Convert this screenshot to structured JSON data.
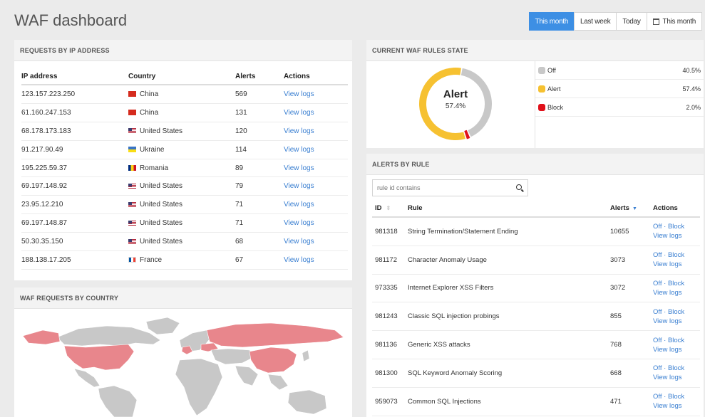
{
  "title": "WAF dashboard",
  "date_range": {
    "buttons": [
      "This month",
      "Last week",
      "Today"
    ],
    "picker_label": "This month",
    "active": "This month"
  },
  "ip_panel": {
    "title": "REQUESTS BY IP ADDRESS",
    "columns": [
      "IP address",
      "Country",
      "Alerts",
      "Actions"
    ],
    "rows": [
      {
        "ip": "123.157.223.250",
        "country": "China",
        "flag": "cn",
        "alerts": "569",
        "action": "View logs"
      },
      {
        "ip": "61.160.247.153",
        "country": "China",
        "flag": "cn",
        "alerts": "131",
        "action": "View logs"
      },
      {
        "ip": "68.178.173.183",
        "country": "United States",
        "flag": "us",
        "alerts": "120",
        "action": "View logs"
      },
      {
        "ip": "91.217.90.49",
        "country": "Ukraine",
        "flag": "ua",
        "alerts": "114",
        "action": "View logs"
      },
      {
        "ip": "195.225.59.37",
        "country": "Romania",
        "flag": "ro",
        "alerts": "89",
        "action": "View logs"
      },
      {
        "ip": "69.197.148.92",
        "country": "United States",
        "flag": "us",
        "alerts": "79",
        "action": "View logs"
      },
      {
        "ip": "23.95.12.210",
        "country": "United States",
        "flag": "us",
        "alerts": "71",
        "action": "View logs"
      },
      {
        "ip": "69.197.148.87",
        "country": "United States",
        "flag": "us",
        "alerts": "71",
        "action": "View logs"
      },
      {
        "ip": "50.30.35.150",
        "country": "United States",
        "flag": "us",
        "alerts": "68",
        "action": "View logs"
      },
      {
        "ip": "188.138.17.205",
        "country": "France",
        "flag": "fr",
        "alerts": "67",
        "action": "View logs"
      }
    ]
  },
  "map_panel": {
    "title": "WAF REQUESTS BY COUNTRY",
    "highlight_color": "#e8868c",
    "base_color": "#c8c8c8"
  },
  "state_panel": {
    "title": "CURRENT WAF RULES STATE",
    "center_label": "Alert",
    "center_value": "57.4%",
    "legend": [
      {
        "name": "Off",
        "pct": "40.5%",
        "value": 40.5,
        "color": "#c8c8c8"
      },
      {
        "name": "Alert",
        "pct": "57.4%",
        "value": 57.4,
        "color": "#f6c131"
      },
      {
        "name": "Block",
        "pct": "2.0%",
        "value": 2.0,
        "color": "#e0101a"
      }
    ]
  },
  "rules_panel": {
    "title": "ALERTS BY RULE",
    "search_placeholder": "rule id contains",
    "columns": [
      "ID",
      "Rule",
      "Alerts",
      "Actions"
    ],
    "rows": [
      {
        "id": "981318",
        "rule": "String Termination/Statement Ending",
        "alerts": "10655",
        "action1": "Off · Block",
        "action2": "View logs"
      },
      {
        "id": "981172",
        "rule": "Character Anomaly Usage",
        "alerts": "3073",
        "action1": "Off · Block",
        "action2": "View logs"
      },
      {
        "id": "973335",
        "rule": "Internet Explorer XSS Filters",
        "alerts": "3072",
        "action1": "Off · Block",
        "action2": "View logs"
      },
      {
        "id": "981243",
        "rule": "Classic SQL injection probings",
        "alerts": "855",
        "action1": "Off · Block",
        "action2": "View logs"
      },
      {
        "id": "981136",
        "rule": "Generic XSS attacks",
        "alerts": "768",
        "action1": "Off · Block",
        "action2": "View logs"
      },
      {
        "id": "981300",
        "rule": "SQL Keyword Anomaly Scoring",
        "alerts": "668",
        "action1": "Off · Block",
        "action2": "View logs"
      },
      {
        "id": "959073",
        "rule": "Common SQL Injections",
        "alerts": "471",
        "action1": "Off · Block",
        "action2": "View logs"
      }
    ]
  }
}
